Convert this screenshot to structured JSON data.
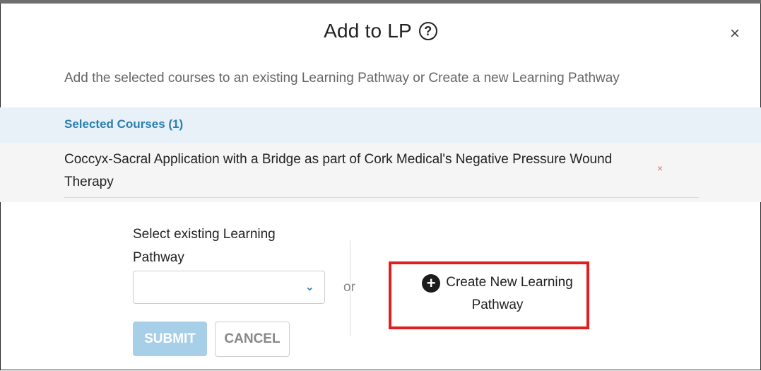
{
  "dialog": {
    "title": "Add to LP",
    "help_icon": "question-circle-icon",
    "close_symbol": "×",
    "subtitle": "Add the selected courses to an existing Learning Pathway or Create a new Learning Pathway"
  },
  "selected_courses": {
    "header": "Selected Courses (1)",
    "items": [
      {
        "title": "Coccyx-Sacral Application with a Bridge as part of Cork Medical's Negative Pressure Wound Therapy",
        "remove_symbol": "×"
      }
    ]
  },
  "existing_pathway": {
    "label": "Select existing Learning Pathway",
    "selected_value": ""
  },
  "separator_text": "or",
  "create_new": {
    "label": "Create New Learning Pathway"
  },
  "buttons": {
    "submit": "SUBMIT",
    "cancel": "CANCEL"
  },
  "colors": {
    "accent": "#2a7fb0",
    "header_bg": "#e8f0f8",
    "submit_disabled": "#a7cfe8",
    "highlight": "#e02020"
  }
}
